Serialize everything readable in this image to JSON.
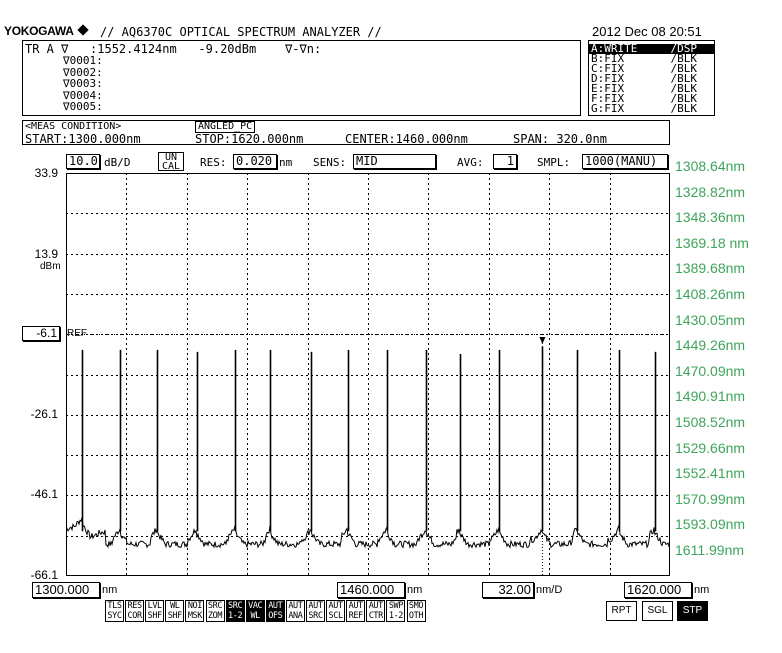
{
  "header": {
    "brand": "YOKOGAWA",
    "title": "// AQ6370C OPTICAL SPECTRUM ANALYZER //",
    "datetime": "2012 Dec 08 20:51"
  },
  "marker_panel": {
    "line1": "TR A ∇   :1552.4124nm   -9.20dBm    ∇-∇n:",
    "markers": [
      "∇0001:",
      "∇0002:",
      "∇0003:",
      "∇0004:",
      "∇0005:"
    ]
  },
  "trace_panel": {
    "traces": [
      {
        "label": "A:WRITE     /DSP",
        "selected": true
      },
      {
        "label": "B:FIX       /BLK",
        "selected": false
      },
      {
        "label": "C:FIX       /BLK",
        "selected": false
      },
      {
        "label": "D:FIX       /BLK",
        "selected": false
      },
      {
        "label": "E:FIX       /BLK",
        "selected": false
      },
      {
        "label": "F:FIX       /BLK",
        "selected": false
      },
      {
        "label": "G:FIX       /BLK",
        "selected": false
      }
    ]
  },
  "meas_condition": {
    "header": "<MEAS CONDITION>",
    "tag": "ANGLED_PC",
    "start": "START:1300.000nm",
    "stop": "STOP:1620.000nm",
    "center": "CENTER:1460.000nm",
    "span": "SPAN: 320.0nm"
  },
  "settings": {
    "scale_value": "10.0",
    "scale_unit": "dB/D",
    "uncal_1": "UN",
    "uncal_2": "CAL",
    "res_label": "RES:",
    "res_value": "0.020",
    "res_unit": "nm",
    "sens_label": "SENS:",
    "sens_value": "MID",
    "avg_label": "AVG:",
    "avg_value": "1",
    "smpl_label": "SMPL:",
    "smpl_value": "1000(MANU)"
  },
  "y_axis": {
    "ticks": [
      "33.9",
      "13.9",
      "-26.1",
      "-46.1",
      "-66.1"
    ],
    "unit": "dBm",
    "ref_value": "-6.1",
    "ref_label": "REF"
  },
  "x_axis": {
    "start": "1300.000",
    "start_unit": "nm",
    "center": "1460.000",
    "center_unit": "nm",
    "div": "32.00",
    "div_unit": "nm/D",
    "stop": "1620.000",
    "stop_unit": "nm"
  },
  "wavelength_annotations": [
    "1308.64nm",
    "1328.82nm",
    "1348.36nm",
    "1369.18 nm",
    "1389.68nm",
    "1408.26nm",
    "1430.05nm",
    "1449.26nm",
    "1470.09nm",
    "1490.91nm",
    "1508.52nm",
    "1529.66nm",
    "1552.41nm",
    "1570.99nm",
    "1593.09nm",
    "1611.99nm"
  ],
  "annotation_color": "#3fa45b",
  "chart_data": {
    "type": "line",
    "xlim": [
      1300.0,
      1620.0
    ],
    "ylim": [
      -66.1,
      33.9
    ],
    "xlabel": "",
    "ylabel": "dBm",
    "grid": true,
    "ref_level": -6.1,
    "noise_floor": -57,
    "marker_x": 1552.41,
    "peaks": [
      {
        "x": 1308.64,
        "y": -10
      },
      {
        "x": 1328.82,
        "y": -10
      },
      {
        "x": 1348.36,
        "y": -10
      },
      {
        "x": 1369.18,
        "y": -10.5
      },
      {
        "x": 1389.68,
        "y": -10
      },
      {
        "x": 1408.26,
        "y": -10
      },
      {
        "x": 1430.05,
        "y": -10.5
      },
      {
        "x": 1449.26,
        "y": -10
      },
      {
        "x": 1470.09,
        "y": -10
      },
      {
        "x": 1490.91,
        "y": -10
      },
      {
        "x": 1508.52,
        "y": -11
      },
      {
        "x": 1529.66,
        "y": -10
      },
      {
        "x": 1552.41,
        "y": -9.2
      },
      {
        "x": 1570.99,
        "y": -10
      },
      {
        "x": 1593.09,
        "y": -10
      },
      {
        "x": 1611.99,
        "y": -10.5
      }
    ]
  },
  "function_keys": [
    {
      "l1": "TLS",
      "l2": "SYC",
      "on": false
    },
    {
      "l1": "RES",
      "l2": "COR",
      "on": false
    },
    {
      "l1": "LVL",
      "l2": "SHF",
      "on": false
    },
    {
      "l1": "WL",
      "l2": "SHF",
      "on": false
    },
    {
      "l1": "NOI",
      "l2": "MSK",
      "on": false
    },
    {
      "l1": "SRC",
      "l2": "ZOM",
      "on": false
    },
    {
      "l1": "SRC",
      "l2": "1-2",
      "on": true
    },
    {
      "l1": "VAC",
      "l2": "WL",
      "on": true
    },
    {
      "l1": "AUT",
      "l2": "OFS",
      "on": true
    },
    {
      "l1": "AUT",
      "l2": "ANA",
      "on": false
    },
    {
      "l1": "AUT",
      "l2": "SRC",
      "on": false
    },
    {
      "l1": "AUT",
      "l2": "SCL",
      "on": false
    },
    {
      "l1": "AUT",
      "l2": "REF",
      "on": false
    },
    {
      "l1": "AUT",
      "l2": "CTR",
      "on": false
    },
    {
      "l1": "SWP",
      "l2": "1-2",
      "on": false
    },
    {
      "l1": "SMO",
      "l2": "OTH",
      "on": false
    }
  ],
  "sweep_keys": [
    {
      "label": "RPT",
      "on": false
    },
    {
      "label": "SGL",
      "on": false
    },
    {
      "label": "STP",
      "on": true
    }
  ]
}
